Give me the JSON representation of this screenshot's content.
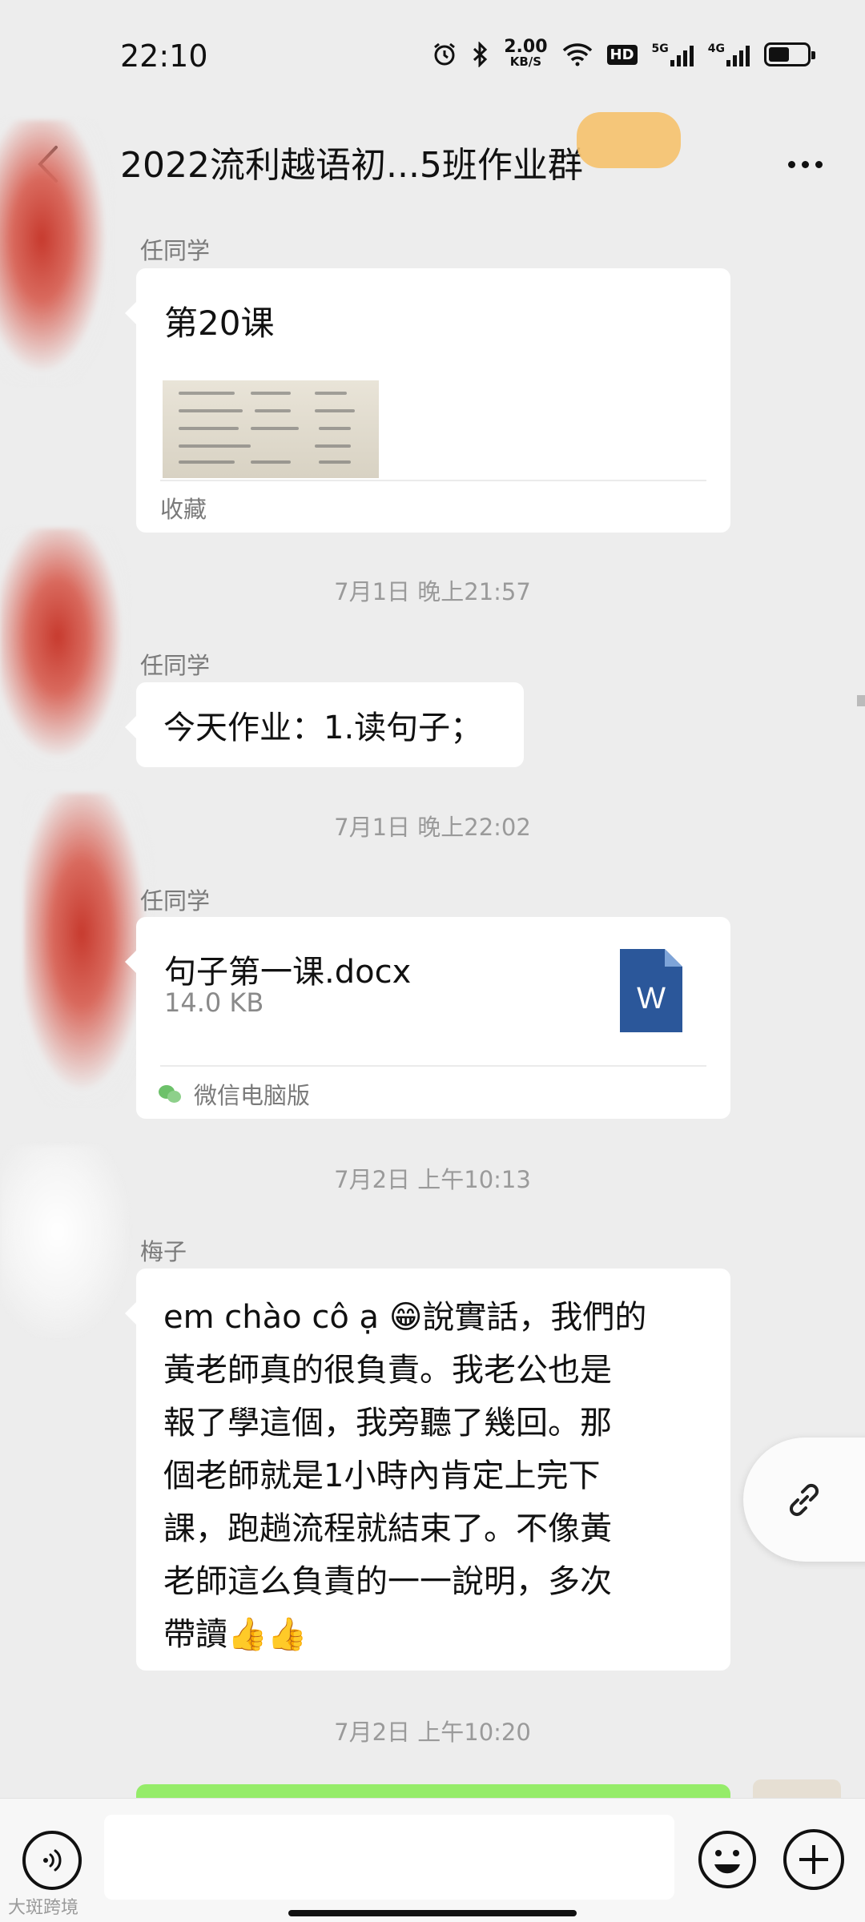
{
  "status_bar": {
    "time": "22:10",
    "speed_value": "2.00",
    "speed_unit": "KB/S",
    "hd_label": "HD",
    "net1_label": "5G",
    "net2_label": "4G",
    "icons": [
      "alarm-icon",
      "bluetooth-icon",
      "wifi-icon",
      "signal-icon",
      "battery-icon"
    ]
  },
  "header": {
    "title": "2022流利越语初...5班作业群"
  },
  "messages": [
    {
      "sender": "任同学",
      "type": "note",
      "title": "第20课",
      "footer": "收藏"
    },
    {
      "timestamp": "7月1日 晚上21:57"
    },
    {
      "sender": "任同学",
      "type": "text",
      "text": "今天作业：1.读句子；"
    },
    {
      "timestamp": "7月1日 晚上22:02"
    },
    {
      "sender": "任同学",
      "type": "file",
      "file_name": "句子第一课.docx",
      "file_size": "14.0 KB",
      "file_icon_letter": "W",
      "footer": "微信电脑版"
    },
    {
      "timestamp": "7月2日 上午10:13"
    },
    {
      "sender": "梅子",
      "type": "text",
      "lines": [
        "em chào cô ạ 😁說實話，我們的",
        "黃老師真的很負責。我老公也是",
        "報了學這個，我旁聽了幾回。那",
        "個老師就是1小時內肯定上完下",
        "課，跑趟流程就結束了。不像黃",
        "老師這么負責的一一說明，多次",
        "帶讀👍👍"
      ]
    },
    {
      "timestamp": "7月2日 上午10:20"
    }
  ],
  "watermark": "大斑跨境",
  "colors": {
    "background": "#ededed",
    "bubble": "#ffffff",
    "my_bubble": "#95ec69",
    "word_blue": "#2b579a"
  }
}
